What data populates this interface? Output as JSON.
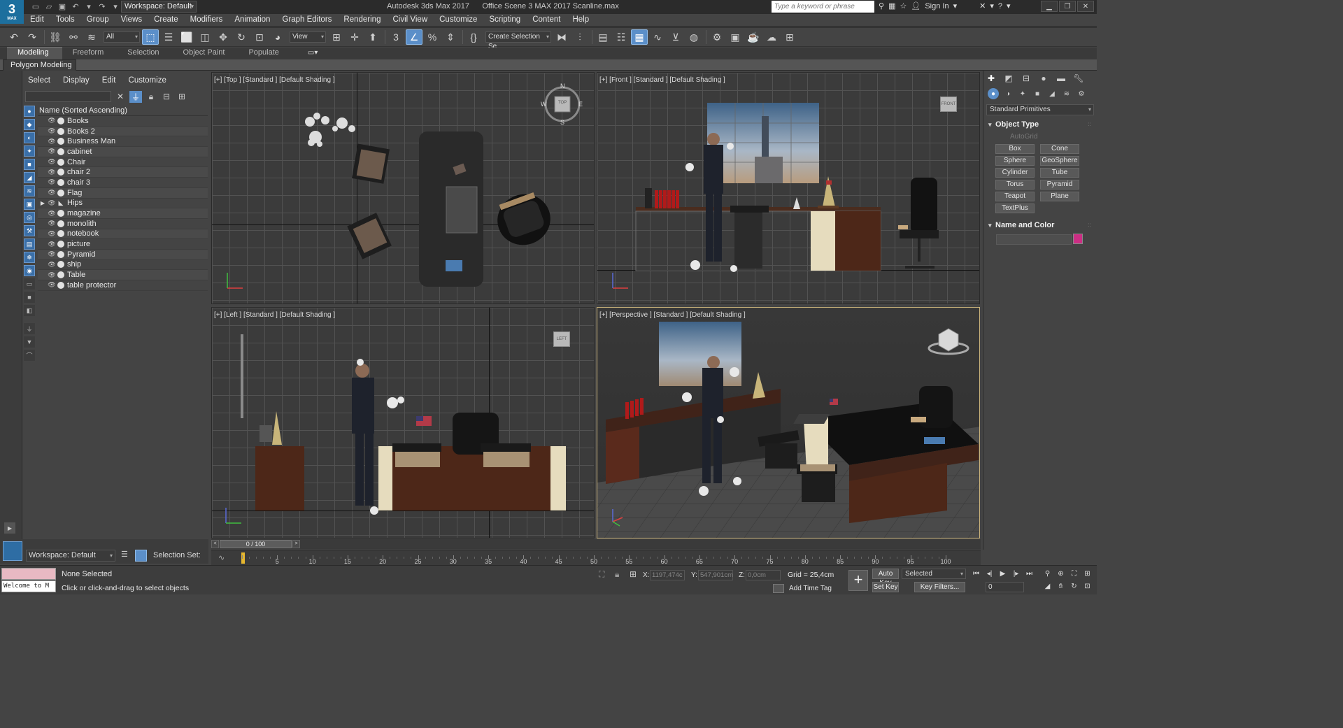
{
  "app": {
    "logo_text": "3",
    "logo_sub": "MAX",
    "title": "Autodesk 3ds Max 2017      Office Scene 3 MAX 2017 Scanline.max",
    "workspace": "Workspace: Default",
    "search_placeholder": "Type a keyword or phrase",
    "sign_in": "Sign In"
  },
  "menu": [
    "Edit",
    "Tools",
    "Group",
    "Views",
    "Create",
    "Modifiers",
    "Animation",
    "Graph Editors",
    "Rendering",
    "Civil View",
    "Customize",
    "Scripting",
    "Content",
    "Help"
  ],
  "toolbar": {
    "filter_dd": "All",
    "refcoord_dd": "View",
    "selection_set_dd": "Create Selection Se"
  },
  "ribbon": {
    "tabs": [
      "Modeling",
      "Freeform",
      "Selection",
      "Object Paint",
      "Populate"
    ],
    "active_tab": "Modeling",
    "panel_label": "Polygon Modeling"
  },
  "scene_explorer": {
    "menu": [
      "Select",
      "Display",
      "Edit",
      "Customize"
    ],
    "column_header": "Name (Sorted Ascending)",
    "objects": [
      {
        "name": "Books"
      },
      {
        "name": "Books 2"
      },
      {
        "name": "Business Man"
      },
      {
        "name": "cabinet"
      },
      {
        "name": "Chair"
      },
      {
        "name": "chair 2"
      },
      {
        "name": "chair 3"
      },
      {
        "name": "Flag"
      },
      {
        "name": "Hips",
        "expandable": true,
        "bone": true
      },
      {
        "name": "magazine"
      },
      {
        "name": "monolith"
      },
      {
        "name": "notebook"
      },
      {
        "name": "picture"
      },
      {
        "name": "Pyramid"
      },
      {
        "name": "ship"
      },
      {
        "name": "Table"
      },
      {
        "name": "table protector"
      }
    ],
    "workspace": "Workspace: Default",
    "selection_set_label": "Selection Set:"
  },
  "viewports": {
    "top": "[+] [Top ] [Standard ] [Default Shading ]",
    "front": "[+] [Front ] [Standard ] [Default Shading ]",
    "left": "[+] [Left ] [Standard ] [Default Shading ]",
    "perspective": "[+] [Perspective ] [Standard ] [Default Shading ]",
    "viewcube_top": "TOP",
    "viewcube_front": "FRONT",
    "viewcube_left": "LEFT",
    "compass_n": "N",
    "compass_s": "S",
    "compass_e": "E",
    "compass_w": "W"
  },
  "command_panel": {
    "primitives_dd": "Standard Primitives",
    "object_type_title": "Object Type",
    "autogrid": "AutoGrid",
    "primitives": [
      "Box",
      "Cone",
      "Sphere",
      "GeoSphere",
      "Cylinder",
      "Tube",
      "Torus",
      "Pyramid",
      "Teapot",
      "Plane",
      "TextPlus"
    ],
    "name_color_title": "Name and Color",
    "color": "#cc2e84"
  },
  "time": {
    "slider_label": "0 / 100",
    "ticks": [
      0,
      5,
      10,
      15,
      20,
      25,
      30,
      35,
      40,
      45,
      50,
      55,
      60,
      65,
      70,
      75,
      80,
      85,
      90,
      95,
      100
    ]
  },
  "status": {
    "listener_text": "Welcome to M",
    "selection": "None Selected",
    "prompt": "Click or click-and-drag to select objects",
    "x_label": "X:",
    "x_value": "1197,474c",
    "y_label": "Y:",
    "y_value": "547,901cm",
    "z_label": "Z:",
    "z_value": "0,0cm",
    "grid": "Grid = 25,4cm",
    "add_time_tag": "Add Time Tag",
    "auto_key": "Auto Key",
    "set_key": "Set Key",
    "key_mode": "Selected",
    "key_filters": "Key Filters...",
    "frame": "0"
  }
}
